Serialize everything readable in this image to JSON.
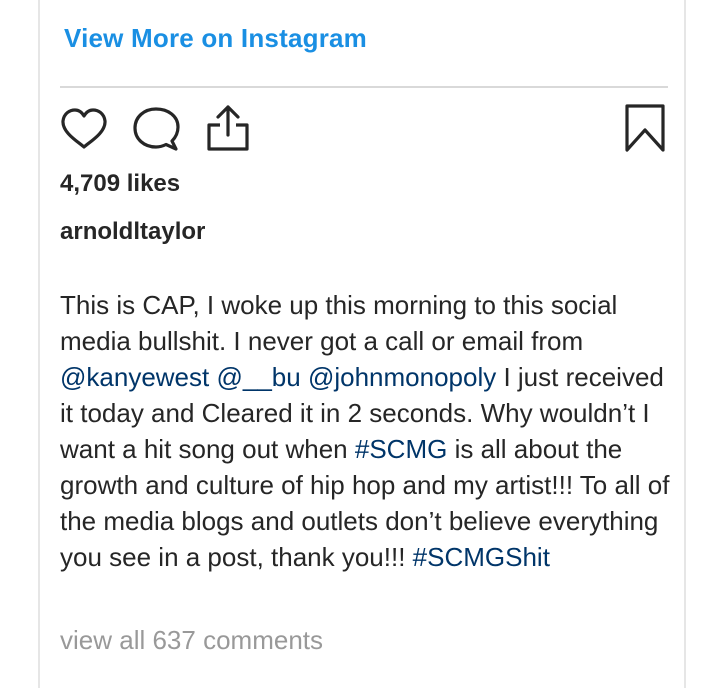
{
  "post": {
    "view_more_label": "View More on Instagram",
    "likes_text": "4,709 likes",
    "username": "arnoldltaylor",
    "caption": [
      {
        "type": "text",
        "text": "This is CAP, I woke up this morning to this social media bullshit. I never got a call or email from "
      },
      {
        "type": "link",
        "text": "@kanyewest",
        "name": "mention-kanyewest"
      },
      {
        "type": "text",
        "text": " "
      },
      {
        "type": "link",
        "text": "@__bu",
        "name": "mention-bu"
      },
      {
        "type": "text",
        "text": " "
      },
      {
        "type": "link",
        "text": "@johnmonopoly",
        "name": "mention-johnmonopoly"
      },
      {
        "type": "text",
        "text": " I just received it today and Cleared it in 2 seconds. Why wouldn’t I want a hit song out when "
      },
      {
        "type": "link",
        "text": "#SCMG",
        "name": "hashtag-scmg"
      },
      {
        "type": "text",
        "text": " is all about the growth and culture of hip hop and my artist!!! To all of the media blogs and outlets don’t believe everything you see in a post, thank you!!! "
      },
      {
        "type": "link",
        "text": "#SCMGShit",
        "name": "hashtag-scmgshit"
      }
    ],
    "comments_link": "view all 637 comments"
  },
  "icons": {
    "like": "heart-icon",
    "comment": "comment-icon",
    "share": "share-icon",
    "save": "bookmark-icon"
  },
  "colors": {
    "view_more": "#1a8fe3",
    "link": "#003569",
    "muted": "#999999",
    "text": "#262626"
  }
}
